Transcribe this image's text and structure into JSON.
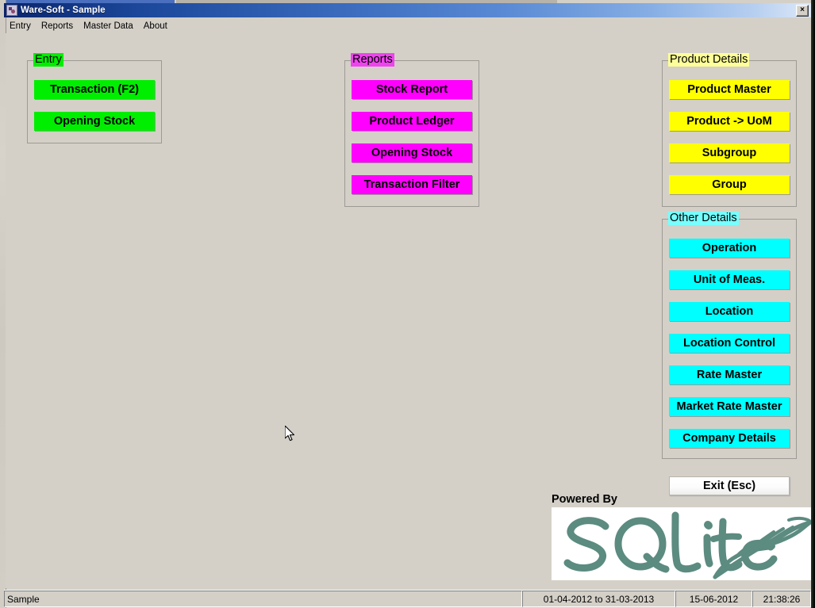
{
  "window": {
    "title": "Ware-Soft - Sample",
    "close_label": "×",
    "app_icon": "app-icon"
  },
  "menubar": {
    "items": [
      {
        "label": "Entry"
      },
      {
        "label": "Reports"
      },
      {
        "label": "Master Data"
      },
      {
        "label": "About"
      }
    ]
  },
  "colors": {
    "entry_accent": "#00ee00",
    "reports_accent": "#ff00ff",
    "product_accent": "#ffff00",
    "other_accent": "#00ffff",
    "titlebar_start": "#0a246a",
    "client_bg": "#d4d0c8"
  },
  "panels": {
    "entry": {
      "title": "Entry",
      "buttons": [
        {
          "label": "Transaction (F2)"
        },
        {
          "label": "Opening Stock"
        }
      ]
    },
    "reports": {
      "title": "Reports",
      "buttons": [
        {
          "label": "Stock Report"
        },
        {
          "label": "Product Ledger"
        },
        {
          "label": "Opening Stock"
        },
        {
          "label": "Transaction Filter"
        }
      ]
    },
    "product_details": {
      "title": "Product Details",
      "buttons": [
        {
          "label": "Product Master"
        },
        {
          "label": "Product -> UoM"
        },
        {
          "label": "Subgroup"
        },
        {
          "label": "Group"
        }
      ]
    },
    "other_details": {
      "title": "Other Details",
      "buttons": [
        {
          "label": "Operation"
        },
        {
          "label": "Unit of Meas."
        },
        {
          "label": "Location"
        },
        {
          "label": "Location Control"
        },
        {
          "label": "Rate Master"
        },
        {
          "label": "Market Rate Master"
        },
        {
          "label": "Company Details"
        }
      ]
    }
  },
  "exit_button": {
    "label": "Exit (Esc)"
  },
  "branding": {
    "powered_by": "Powered By",
    "logo_text": "SQLite"
  },
  "statusbar": {
    "company": "Sample",
    "period": "01-04-2012 to 31-03-2013",
    "date": "15-06-2012",
    "time": "21:38:26"
  }
}
